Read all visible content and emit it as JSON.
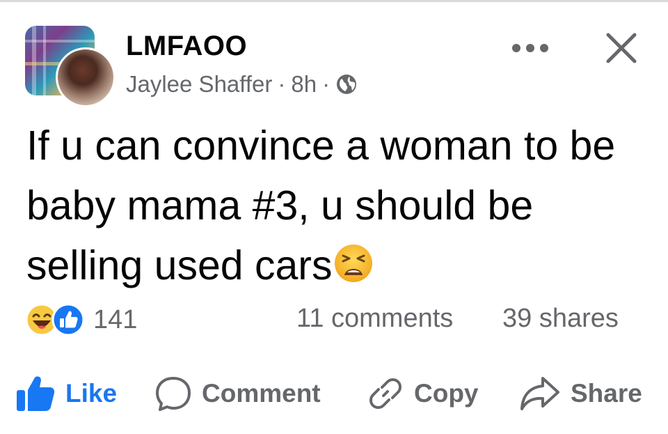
{
  "post": {
    "group_name": "LMFAOO",
    "author": "Jaylee Shaffer",
    "time": "8h",
    "separator": "·",
    "privacy_icon": "globe-icon",
    "text": "If u can convince a woman to be baby mama #3, u should be selling used cars",
    "emoji_icon": "weary-face-icon"
  },
  "engagement": {
    "reaction_icons": [
      "haha-icon",
      "like-icon"
    ],
    "reaction_count": "141",
    "comments": "11 comments",
    "shares": "39 shares"
  },
  "actions": {
    "like": "Like",
    "comment": "Comment",
    "copy": "Copy",
    "share": "Share"
  },
  "colors": {
    "like_blue": "#1877f2",
    "secondary_gray": "#65676b",
    "text": "#050505",
    "haha_yellow": "#f7c940"
  }
}
